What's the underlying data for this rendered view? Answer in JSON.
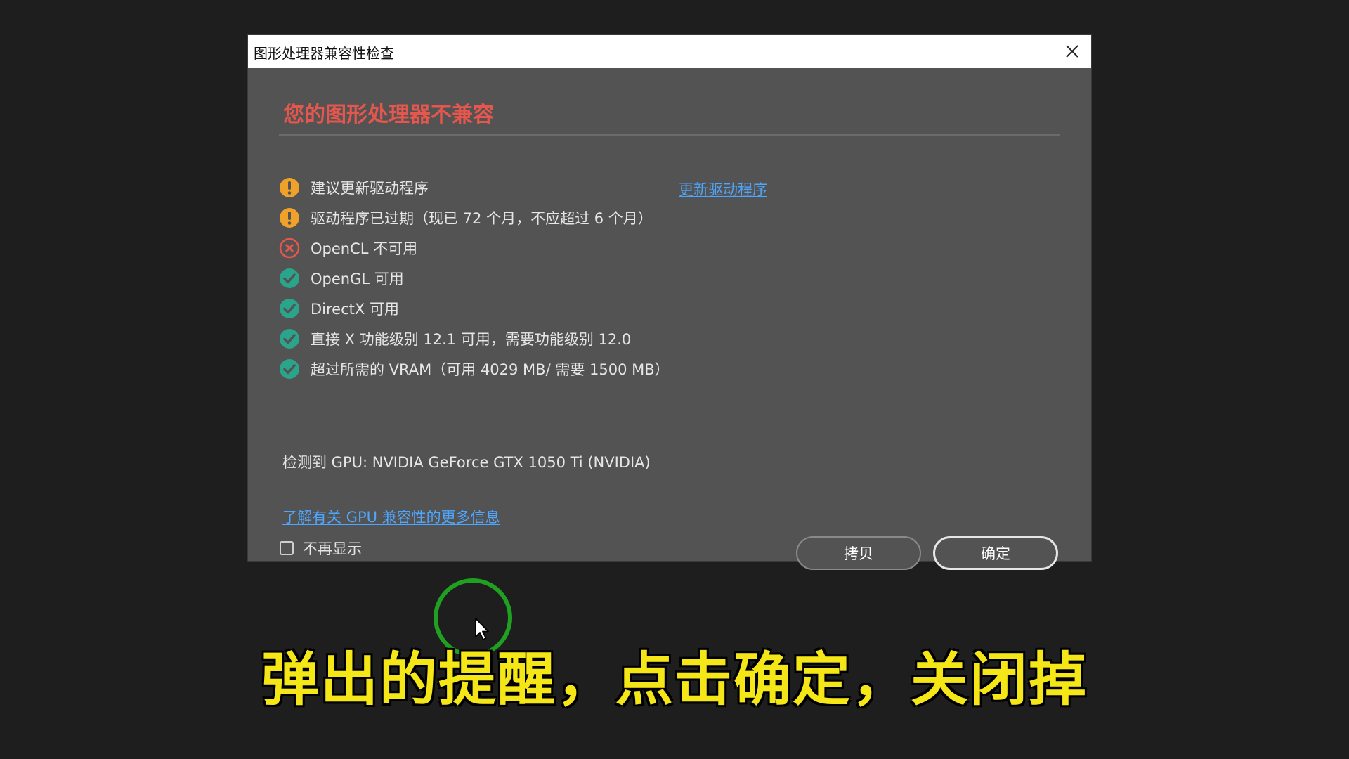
{
  "dialog": {
    "title": "图形处理器兼容性检查",
    "heading": "您的图形处理器不兼容",
    "checks": [
      {
        "status": "warning",
        "icon": "warning-icon",
        "text": "建议更新驱动程序",
        "link": "更新驱动程序"
      },
      {
        "status": "warning",
        "icon": "warning-icon",
        "text": "驱动程序已过期（现已 72 个月，不应超过 6 个月）"
      },
      {
        "status": "error",
        "icon": "error-icon",
        "text": "OpenCL 不可用"
      },
      {
        "status": "ok",
        "icon": "check-icon",
        "text": "OpenGL 可用"
      },
      {
        "status": "ok",
        "icon": "check-icon",
        "text": "DirectX 可用"
      },
      {
        "status": "ok",
        "icon": "check-icon",
        "text": "直接 X 功能级别 12.1 可用，需要功能级别 12.0"
      },
      {
        "status": "ok",
        "icon": "check-icon",
        "text": "超过所需的 VRAM（可用 4029 MB/ 需要 1500 MB）"
      }
    ],
    "gpu_detected": "检测到 GPU: NVIDIA GeForce GTX 1050 Ti (NVIDIA)",
    "more_info_link": "了解有关 GPU 兼容性的更多信息",
    "dont_show_label": "不再显示",
    "dont_show_checked": false,
    "copy_button": "拷贝",
    "ok_button": "确定"
  },
  "subtitle": "弹出的提醒，点击确定，关闭掉",
  "colors": {
    "background": "#1e1e1e",
    "dialog_bg": "#535353",
    "heading": "#e5564d",
    "link": "#4ea6ff",
    "warning": "#f0a12a",
    "error": "#e5564d",
    "ok": "#2aa58b",
    "subtitle": "#f5e617",
    "click_ring": "#1fa021"
  }
}
